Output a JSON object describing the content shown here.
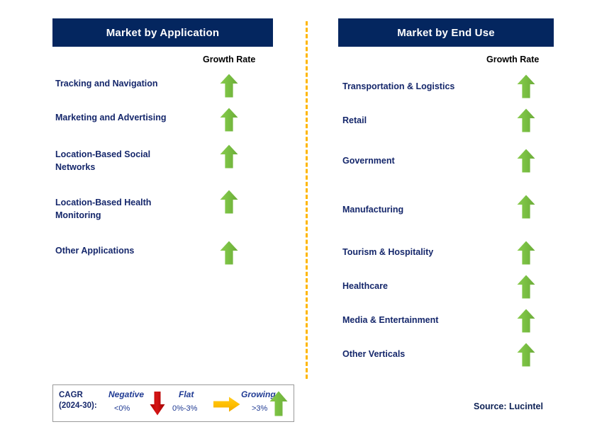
{
  "colors": {
    "header_bg": "#04265f",
    "header_text": "#ffffff",
    "label_text": "#15276b",
    "growing_green": "#7ac143",
    "negative_red": "#c00000",
    "flat_orange": "#ffc000",
    "divider_orange": "#ffb600",
    "legend_border": "#9a9a9a",
    "source_text": "#0d2155"
  },
  "left_panel": {
    "title": "Market by Application",
    "growth_caption": "Growth Rate",
    "rows": [
      {
        "label": "Tracking and Navigation",
        "growth": "growing",
        "icon": "arrow-up-icon"
      },
      {
        "label": "Marketing and Advertising",
        "growth": "growing",
        "icon": "arrow-up-icon"
      },
      {
        "label": "Location-Based Social\nNetworks",
        "growth": "growing",
        "icon": "arrow-up-icon"
      },
      {
        "label": "Location-Based Health\nMonitoring",
        "growth": "growing",
        "icon": "arrow-up-icon"
      },
      {
        "label": "Other Applications",
        "growth": "growing",
        "icon": "arrow-up-icon"
      }
    ]
  },
  "right_panel": {
    "title": "Market by End Use",
    "growth_caption": "Growth Rate",
    "rows": [
      {
        "label": "Transportation & Logistics",
        "growth": "growing",
        "icon": "arrow-up-icon"
      },
      {
        "label": "Retail",
        "growth": "growing",
        "icon": "arrow-up-icon"
      },
      {
        "label": "Government",
        "growth": "growing",
        "icon": "arrow-up-icon"
      },
      {
        "label": "Manufacturing",
        "growth": "growing",
        "icon": "arrow-up-icon"
      },
      {
        "label": "Tourism & Hospitality",
        "growth": "growing",
        "icon": "arrow-up-icon"
      },
      {
        "label": "Healthcare",
        "growth": "growing",
        "icon": "arrow-up-icon"
      },
      {
        "label": "Media & Entertainment",
        "growth": "growing",
        "icon": "arrow-up-icon"
      },
      {
        "label": "Other Verticals",
        "growth": "growing",
        "icon": "arrow-up-icon"
      }
    ]
  },
  "legend": {
    "cagr_label": "CAGR\n(2024-30):",
    "entries": [
      {
        "term": "Negative",
        "value": "<0%",
        "icon": "arrow-down-icon"
      },
      {
        "term": "Flat",
        "value": "0%-3%",
        "icon": "arrow-right-icon"
      },
      {
        "term": "Growing",
        "value": ">3%",
        "icon": "arrow-up-icon"
      }
    ]
  },
  "source": "Source: Lucintel",
  "chart_data": {
    "type": "table",
    "title": "Market Growth Rate by Segment",
    "legend_position": "bottom-left",
    "grid": false,
    "categories_axis": "segment",
    "value_axis": "CAGR (2024-30) growth class",
    "value_scale": [
      {
        "class": "Negative",
        "range": "<0%",
        "symbol": "down arrow",
        "color": "#c00000"
      },
      {
        "class": "Flat",
        "range": "0%-3%",
        "symbol": "right arrow",
        "color": "#ffc000"
      },
      {
        "class": "Growing",
        "range": ">3%",
        "symbol": "up arrow",
        "color": "#7ac143"
      }
    ],
    "series": [
      {
        "name": "Market by Application",
        "categories": [
          "Tracking and Navigation",
          "Marketing and Advertising",
          "Location-Based Social Networks",
          "Location-Based Health Monitoring",
          "Other Applications"
        ],
        "values": [
          "Growing",
          "Growing",
          "Growing",
          "Growing",
          "Growing"
        ]
      },
      {
        "name": "Market by End Use",
        "categories": [
          "Transportation & Logistics",
          "Retail",
          "Government",
          "Manufacturing",
          "Tourism & Hospitality",
          "Healthcare",
          "Media & Entertainment",
          "Other Verticals"
        ],
        "values": [
          "Growing",
          "Growing",
          "Growing",
          "Growing",
          "Growing",
          "Growing",
          "Growing",
          "Growing"
        ]
      }
    ],
    "source": "Source: Lucintel"
  },
  "layout": {
    "left_rows_y": [
      109,
      157,
      209,
      277,
      345
    ],
    "left_arrows_y": [
      104,
      152,
      204,
      268,
      340
    ],
    "right_rows_y": [
      113,
      161,
      218,
      287,
      347,
      395,
      443,
      491
    ],
    "right_arrows_y": [
      105,
      153,
      210,
      275,
      340,
      388,
      436,
      484
    ]
  }
}
